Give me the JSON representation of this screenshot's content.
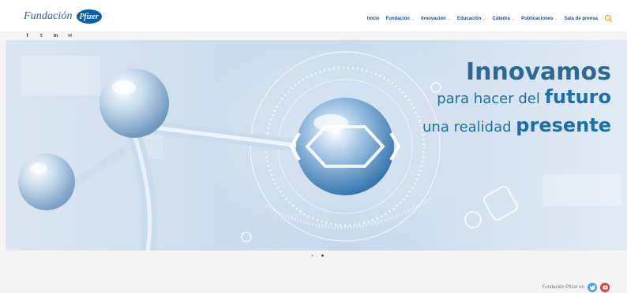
{
  "brand": {
    "name": "Fundación",
    "badge": "Pfizer"
  },
  "nav": [
    {
      "label": "Inicio",
      "has_dropdown": false
    },
    {
      "label": "Fundación",
      "has_dropdown": true
    },
    {
      "label": "Innovación",
      "has_dropdown": true
    },
    {
      "label": "Educación",
      "has_dropdown": true
    },
    {
      "label": "Cátedra",
      "has_dropdown": true
    },
    {
      "label": "Publicaciones",
      "has_dropdown": true
    },
    {
      "label": "Sala de prensa",
      "has_dropdown": false
    }
  ],
  "social_icons": [
    "facebook-icon",
    "twitter-icon",
    "linkedin-icon",
    "email-icon"
  ],
  "social_glyphs": {
    "facebook": "f",
    "twitter": "𝕥",
    "linkedin": "in",
    "email": "✉"
  },
  "hero": {
    "title": "Innovamos",
    "line2_a": "para hacer del ",
    "line2_b": "futuro",
    "line3_a": "una realidad ",
    "line3_b": "presente"
  },
  "carousel": {
    "count": 2,
    "active": 2
  },
  "footer": {
    "label": "Fundación Pfizer en"
  },
  "colors": {
    "brand_blue": "#1a4f96",
    "search": "#f0a51c",
    "twitter": "#4aa3ea",
    "youtube": "#e43b3b"
  }
}
